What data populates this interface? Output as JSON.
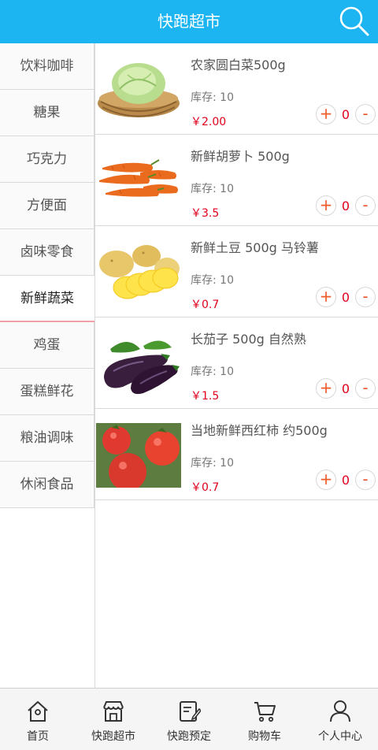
{
  "header": {
    "title": "快跑超市",
    "search_icon": "search-icon"
  },
  "categories": [
    {
      "label": "饮料咖啡"
    },
    {
      "label": "糖果"
    },
    {
      "label": "巧克力"
    },
    {
      "label": "方便面"
    },
    {
      "label": "卤味零食"
    },
    {
      "label": "新鲜蔬菜",
      "active": true
    },
    {
      "label": "鸡蛋"
    },
    {
      "label": "蛋糕鲜花"
    },
    {
      "label": "粮油调味"
    },
    {
      "label": "休闲食品"
    }
  ],
  "products": [
    {
      "name": "农家圆白菜500g",
      "stock_label": "库存:",
      "stock": "10",
      "price": "￥2.00",
      "qty": "0",
      "image": "cabbage"
    },
    {
      "name": "新鲜胡萝卜 500g",
      "stock_label": "库存:",
      "stock": "10",
      "price": "￥3.5",
      "qty": "0",
      "image": "carrots"
    },
    {
      "name": "新鲜土豆 500g 马铃薯",
      "stock_label": "库存:",
      "stock": "10",
      "price": "￥0.7",
      "qty": "0",
      "image": "potatoes"
    },
    {
      "name": "长茄子 500g 自然熟",
      "stock_label": "库存:",
      "stock": "10",
      "price": "￥1.5",
      "qty": "0",
      "image": "eggplants"
    },
    {
      "name": "当地新鲜西红柿 约500g",
      "stock_label": "库存:",
      "stock": "10",
      "price": "￥0.7",
      "qty": "0",
      "image": "tomatoes"
    }
  ],
  "qty_controls": {
    "plus": "+",
    "minus": "-"
  },
  "tabs": [
    {
      "label": "首页",
      "icon": "home-icon"
    },
    {
      "label": "快跑超市",
      "icon": "store-icon"
    },
    {
      "label": "快跑预定",
      "icon": "edit-icon"
    },
    {
      "label": "购物车",
      "icon": "cart-icon"
    },
    {
      "label": "个人中心",
      "icon": "user-icon"
    }
  ],
  "colors": {
    "header": "#1cb5f2",
    "price": "#e0001b",
    "accent": "#f05a28"
  }
}
